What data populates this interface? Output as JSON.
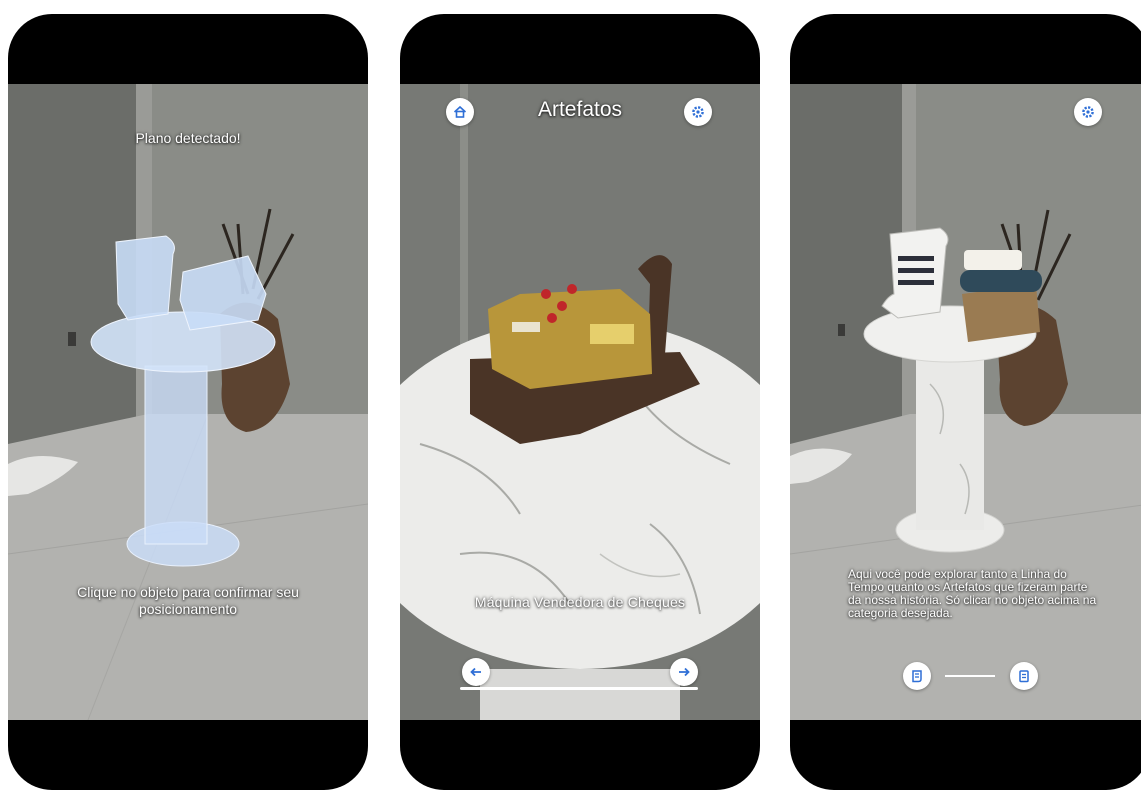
{
  "screens": [
    {
      "top_message": "Plano detectado!",
      "bottom_message": "Clique no objeto para confirmar seu posicionamento"
    },
    {
      "title": "Artefatos",
      "artifact_name": "Máquina Vendedora de Cheques",
      "icons": [
        "home-icon",
        "settings-icon",
        "arrow-left-icon",
        "arrow-right-icon"
      ]
    },
    {
      "info_message": "Aqui você pode explorar tanto a Linha do Tempo quanto os Artefatos que fizeram parte da nossa história. Só clicar no objeto acima na categoria desejada.",
      "icons": [
        "settings-icon",
        "scroll-icon",
        "document-icon"
      ]
    }
  ],
  "colors": {
    "accent": "#2f6fd6",
    "wall": "#7b7d78",
    "floor": "#b4b4b1",
    "hologram": "#c9dcf7",
    "artifact_gold": "#b8963a",
    "artifact_brown": "#4a3426"
  }
}
